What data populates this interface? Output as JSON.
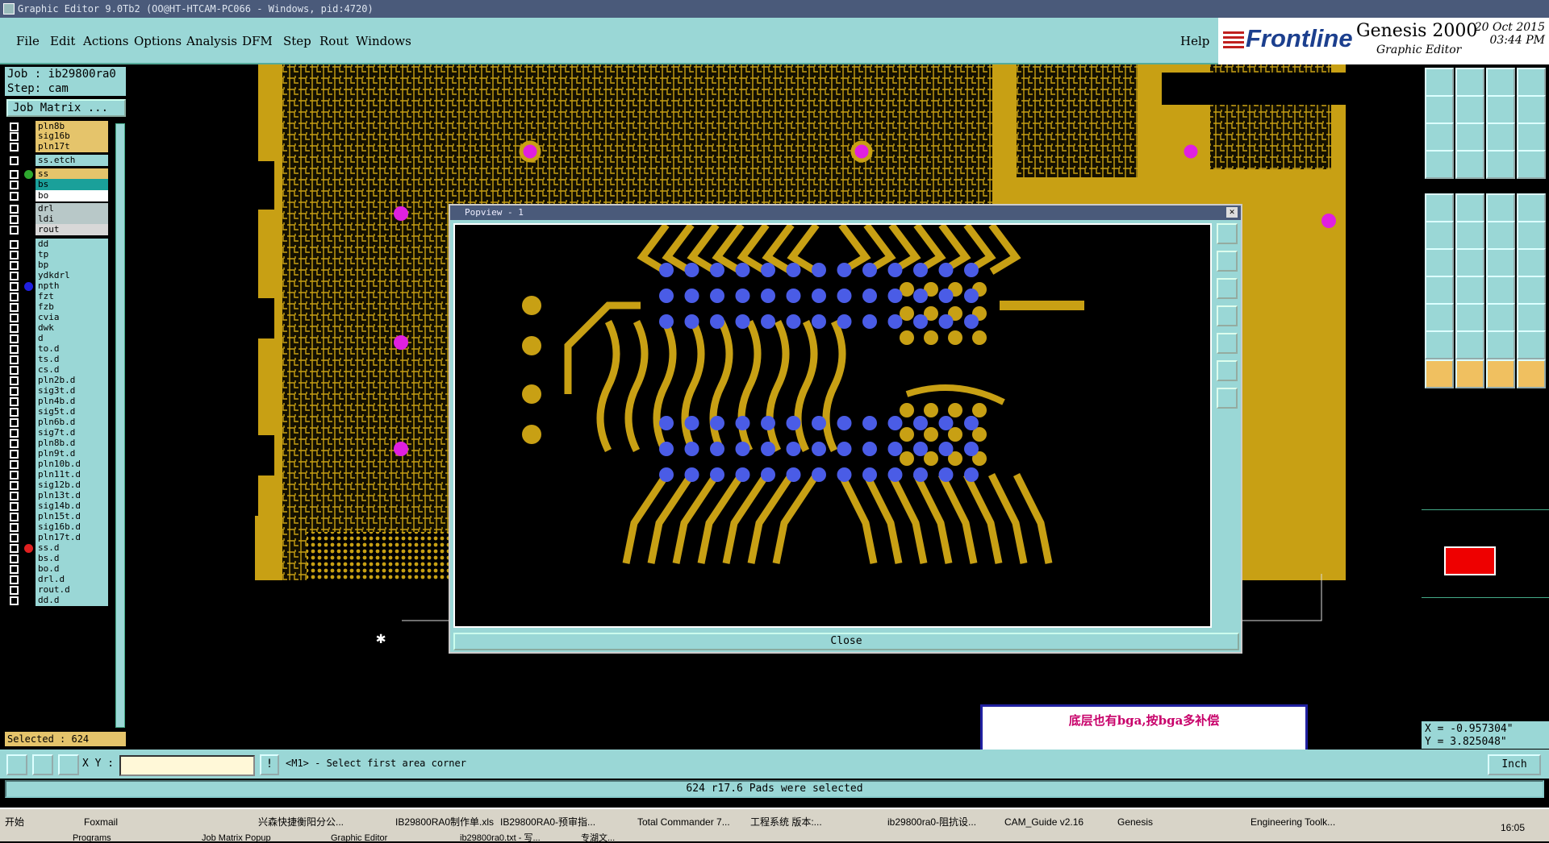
{
  "window_title": "Graphic Editor 9.0Tb2 (OO@HT-HTCAM-PC066 - Windows, pid:4720)",
  "menu": [
    "File",
    "Edit",
    "Actions",
    "Options",
    "Analysis",
    "DFM",
    "Step",
    "Rout",
    "Windows"
  ],
  "help": "Help",
  "brand": {
    "logo": "Frontline",
    "product": "Genesis 2000",
    "subtitle": "Graphic Editor",
    "date": "20 Oct 2015",
    "time": "03:44 PM"
  },
  "job": {
    "job": "Job : ib29800ra0",
    "step": "Step: cam",
    "matrix_button": "Job Matrix ..."
  },
  "layers": [
    {
      "name": "pln8b",
      "color": "#e5c46b"
    },
    {
      "name": "sig16b",
      "color": "#e5c46b"
    },
    {
      "name": "pln17t",
      "color": "#e5c46b"
    },
    {
      "name": "ss.etch",
      "color": "#9ad7d6"
    },
    {
      "name": "ss",
      "color": "#e5c46b",
      "dot": "#2ea82e"
    },
    {
      "name": "bs",
      "color": "#1aa09a"
    },
    {
      "name": "bo",
      "color": "#ffffff"
    },
    {
      "name": "drl",
      "color": "#b8c8c8"
    },
    {
      "name": "ldi",
      "color": "#b8c8c8"
    },
    {
      "name": "rout",
      "color": "#d8d8d8"
    },
    {
      "name": "dd",
      "color": "#9ad7d6"
    },
    {
      "name": "tp",
      "color": "#9ad7d6"
    },
    {
      "name": "bp",
      "color": "#9ad7d6"
    },
    {
      "name": "ydkdrl",
      "color": "#9ad7d6"
    },
    {
      "name": "npth",
      "color": "#9ad7d6",
      "dot": "#2020e0"
    },
    {
      "name": "fzt",
      "color": "#9ad7d6"
    },
    {
      "name": "fzb",
      "color": "#9ad7d6"
    },
    {
      "name": "cvia",
      "color": "#9ad7d6"
    },
    {
      "name": "dwk",
      "color": "#9ad7d6"
    },
    {
      "name": "d",
      "color": "#9ad7d6"
    },
    {
      "name": "to.d",
      "color": "#9ad7d6"
    },
    {
      "name": "ts.d",
      "color": "#9ad7d6"
    },
    {
      "name": "cs.d",
      "color": "#9ad7d6"
    },
    {
      "name": "pln2b.d",
      "color": "#9ad7d6"
    },
    {
      "name": "sig3t.d",
      "color": "#9ad7d6"
    },
    {
      "name": "pln4b.d",
      "color": "#9ad7d6"
    },
    {
      "name": "sig5t.d",
      "color": "#9ad7d6"
    },
    {
      "name": "pln6b.d",
      "color": "#9ad7d6"
    },
    {
      "name": "sig7t.d",
      "color": "#9ad7d6"
    },
    {
      "name": "pln8b.d",
      "color": "#9ad7d6"
    },
    {
      "name": "pln9t.d",
      "color": "#9ad7d6"
    },
    {
      "name": "pln10b.d",
      "color": "#9ad7d6"
    },
    {
      "name": "pln11t.d",
      "color": "#9ad7d6"
    },
    {
      "name": "sig12b.d",
      "color": "#9ad7d6"
    },
    {
      "name": "pln13t.d",
      "color": "#9ad7d6"
    },
    {
      "name": "sig14b.d",
      "color": "#9ad7d6"
    },
    {
      "name": "pln15t.d",
      "color": "#9ad7d6"
    },
    {
      "name": "sig16b.d",
      "color": "#9ad7d6"
    },
    {
      "name": "pln17t.d",
      "color": "#9ad7d6"
    },
    {
      "name": "ss.d",
      "color": "#9ad7d6",
      "dot": "#e02020"
    },
    {
      "name": "bs.d",
      "color": "#9ad7d6"
    },
    {
      "name": "bo.d",
      "color": "#9ad7d6"
    },
    {
      "name": "drl.d",
      "color": "#9ad7d6"
    },
    {
      "name": "rout.d",
      "color": "#9ad7d6"
    },
    {
      "name": "dd.d",
      "color": "#9ad7d6"
    }
  ],
  "selected": "Selected : 624",
  "popup": {
    "title": "Popview - 1",
    "close": "Close"
  },
  "note": "底层也有bga,按bga多补偿",
  "coords": {
    "x": "X = -0.957304\"",
    "y": "Y = 3.825048\""
  },
  "status": {
    "xy_label": "X Y :",
    "xy_value": "",
    "prompt": "<M1> - Select first area corner",
    "unit": "Inch"
  },
  "message": "624 r17.6 Pads were selected",
  "taskbar": {
    "start": "开始",
    "row1": [
      "Foxmail",
      "兴森快捷衡阳分公...",
      "IB29800RA0制作单.xls",
      "IB29800RA0-预审指...",
      "Total Commander 7...",
      "工程系统  版本:...",
      "ib29800ra0-阻抗设...",
      "CAM_Guide v2.16",
      "Genesis",
      "Engineering Toolk..."
    ],
    "row2": [
      "Programs",
      "Job Matrix Popup",
      "Graphic Editor",
      "ib29800ra0.txt - 写...",
      "专湖文..."
    ],
    "clock": "16:05"
  },
  "colors": {
    "copper": "#c8a014",
    "pad_blue": "#4a5ce6",
    "magenta": "#e020e0",
    "panel": "#9ad7d6"
  }
}
